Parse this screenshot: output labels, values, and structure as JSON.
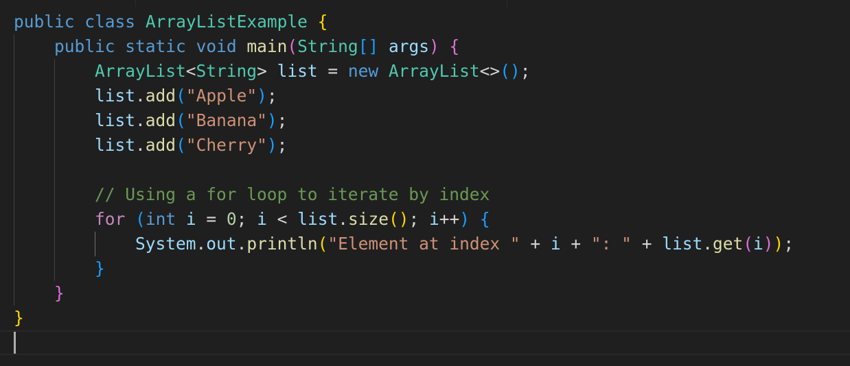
{
  "colors": {
    "background": "#1f1f1f",
    "keyword": "#569cd6",
    "control": "#c586c0",
    "type": "#4ec9b0",
    "function": "#dcdcaa",
    "variable": "#9cdcfe",
    "string": "#ce9178",
    "number": "#b5cea8",
    "comment": "#6a9955",
    "bracket_level1": "#ffd700",
    "bracket_level2": "#da70d6",
    "bracket_level3": "#179fff"
  },
  "code": {
    "lines": [
      [
        {
          "t": "public",
          "c": "kw"
        },
        {
          "t": " ",
          "c": "op"
        },
        {
          "t": "class",
          "c": "kw"
        },
        {
          "t": " ",
          "c": "op"
        },
        {
          "t": "ArrayListExample",
          "c": "typ"
        },
        {
          "t": " ",
          "c": "op"
        },
        {
          "t": "{",
          "c": "b1"
        }
      ],
      [
        {
          "t": "    ",
          "c": "op"
        },
        {
          "t": "public",
          "c": "kw"
        },
        {
          "t": " ",
          "c": "op"
        },
        {
          "t": "static",
          "c": "kw"
        },
        {
          "t": " ",
          "c": "op"
        },
        {
          "t": "void",
          "c": "kw"
        },
        {
          "t": " ",
          "c": "op"
        },
        {
          "t": "main",
          "c": "fn"
        },
        {
          "t": "(",
          "c": "b2"
        },
        {
          "t": "String",
          "c": "typ"
        },
        {
          "t": "[]",
          "c": "b3"
        },
        {
          "t": " ",
          "c": "op"
        },
        {
          "t": "args",
          "c": "var"
        },
        {
          "t": ")",
          "c": "b2"
        },
        {
          "t": " ",
          "c": "op"
        },
        {
          "t": "{",
          "c": "b2"
        }
      ],
      [
        {
          "t": "        ",
          "c": "op"
        },
        {
          "t": "ArrayList",
          "c": "typ"
        },
        {
          "t": "<",
          "c": "op"
        },
        {
          "t": "String",
          "c": "typ"
        },
        {
          "t": ">",
          "c": "op"
        },
        {
          "t": " ",
          "c": "op"
        },
        {
          "t": "list",
          "c": "var"
        },
        {
          "t": " = ",
          "c": "op"
        },
        {
          "t": "new",
          "c": "kw"
        },
        {
          "t": " ",
          "c": "op"
        },
        {
          "t": "ArrayList",
          "c": "typ"
        },
        {
          "t": "<>",
          "c": "op"
        },
        {
          "t": "()",
          "c": "b3"
        },
        {
          "t": ";",
          "c": "op"
        }
      ],
      [
        {
          "t": "        ",
          "c": "op"
        },
        {
          "t": "list",
          "c": "var"
        },
        {
          "t": ".",
          "c": "op"
        },
        {
          "t": "add",
          "c": "fn"
        },
        {
          "t": "(",
          "c": "b3"
        },
        {
          "t": "\"Apple\"",
          "c": "str"
        },
        {
          "t": ")",
          "c": "b3"
        },
        {
          "t": ";",
          "c": "op"
        }
      ],
      [
        {
          "t": "        ",
          "c": "op"
        },
        {
          "t": "list",
          "c": "var"
        },
        {
          "t": ".",
          "c": "op"
        },
        {
          "t": "add",
          "c": "fn"
        },
        {
          "t": "(",
          "c": "b3"
        },
        {
          "t": "\"Banana\"",
          "c": "str"
        },
        {
          "t": ")",
          "c": "b3"
        },
        {
          "t": ";",
          "c": "op"
        }
      ],
      [
        {
          "t": "        ",
          "c": "op"
        },
        {
          "t": "list",
          "c": "var"
        },
        {
          "t": ".",
          "c": "op"
        },
        {
          "t": "add",
          "c": "fn"
        },
        {
          "t": "(",
          "c": "b3"
        },
        {
          "t": "\"Cherry\"",
          "c": "str"
        },
        {
          "t": ")",
          "c": "b3"
        },
        {
          "t": ";",
          "c": "op"
        }
      ],
      [],
      [
        {
          "t": "        ",
          "c": "op"
        },
        {
          "t": "// Using a for loop to iterate by index",
          "c": "cmt"
        }
      ],
      [
        {
          "t": "        ",
          "c": "op"
        },
        {
          "t": "for",
          "c": "ctl"
        },
        {
          "t": " ",
          "c": "op"
        },
        {
          "t": "(",
          "c": "b3"
        },
        {
          "t": "int",
          "c": "kw"
        },
        {
          "t": " ",
          "c": "op"
        },
        {
          "t": "i",
          "c": "var"
        },
        {
          "t": " = ",
          "c": "op"
        },
        {
          "t": "0",
          "c": "num"
        },
        {
          "t": "; ",
          "c": "op"
        },
        {
          "t": "i",
          "c": "var"
        },
        {
          "t": " < ",
          "c": "op"
        },
        {
          "t": "list",
          "c": "var"
        },
        {
          "t": ".",
          "c": "op"
        },
        {
          "t": "size",
          "c": "fn"
        },
        {
          "t": "()",
          "c": "b1"
        },
        {
          "t": "; ",
          "c": "op"
        },
        {
          "t": "i",
          "c": "var"
        },
        {
          "t": "++",
          "c": "op"
        },
        {
          "t": ")",
          "c": "b3"
        },
        {
          "t": " ",
          "c": "op"
        },
        {
          "t": "{",
          "c": "b3"
        }
      ],
      [
        {
          "t": "            ",
          "c": "op"
        },
        {
          "t": "System",
          "c": "var"
        },
        {
          "t": ".",
          "c": "op"
        },
        {
          "t": "out",
          "c": "var"
        },
        {
          "t": ".",
          "c": "op"
        },
        {
          "t": "println",
          "c": "fn"
        },
        {
          "t": "(",
          "c": "b1"
        },
        {
          "t": "\"Element at index \"",
          "c": "str"
        },
        {
          "t": " + ",
          "c": "op"
        },
        {
          "t": "i",
          "c": "var"
        },
        {
          "t": " + ",
          "c": "op"
        },
        {
          "t": "\": \"",
          "c": "str"
        },
        {
          "t": " + ",
          "c": "op"
        },
        {
          "t": "list",
          "c": "var"
        },
        {
          "t": ".",
          "c": "op"
        },
        {
          "t": "get",
          "c": "fn"
        },
        {
          "t": "(",
          "c": "b2"
        },
        {
          "t": "i",
          "c": "var"
        },
        {
          "t": ")",
          "c": "b2"
        },
        {
          "t": ")",
          "c": "b1"
        },
        {
          "t": ";",
          "c": "op"
        }
      ],
      [
        {
          "t": "        ",
          "c": "op"
        },
        {
          "t": "}",
          "c": "b3"
        }
      ],
      [
        {
          "t": "    ",
          "c": "op"
        },
        {
          "t": "}",
          "c": "b2"
        }
      ],
      [
        {
          "t": "}",
          "c": "b1"
        }
      ],
      []
    ]
  }
}
